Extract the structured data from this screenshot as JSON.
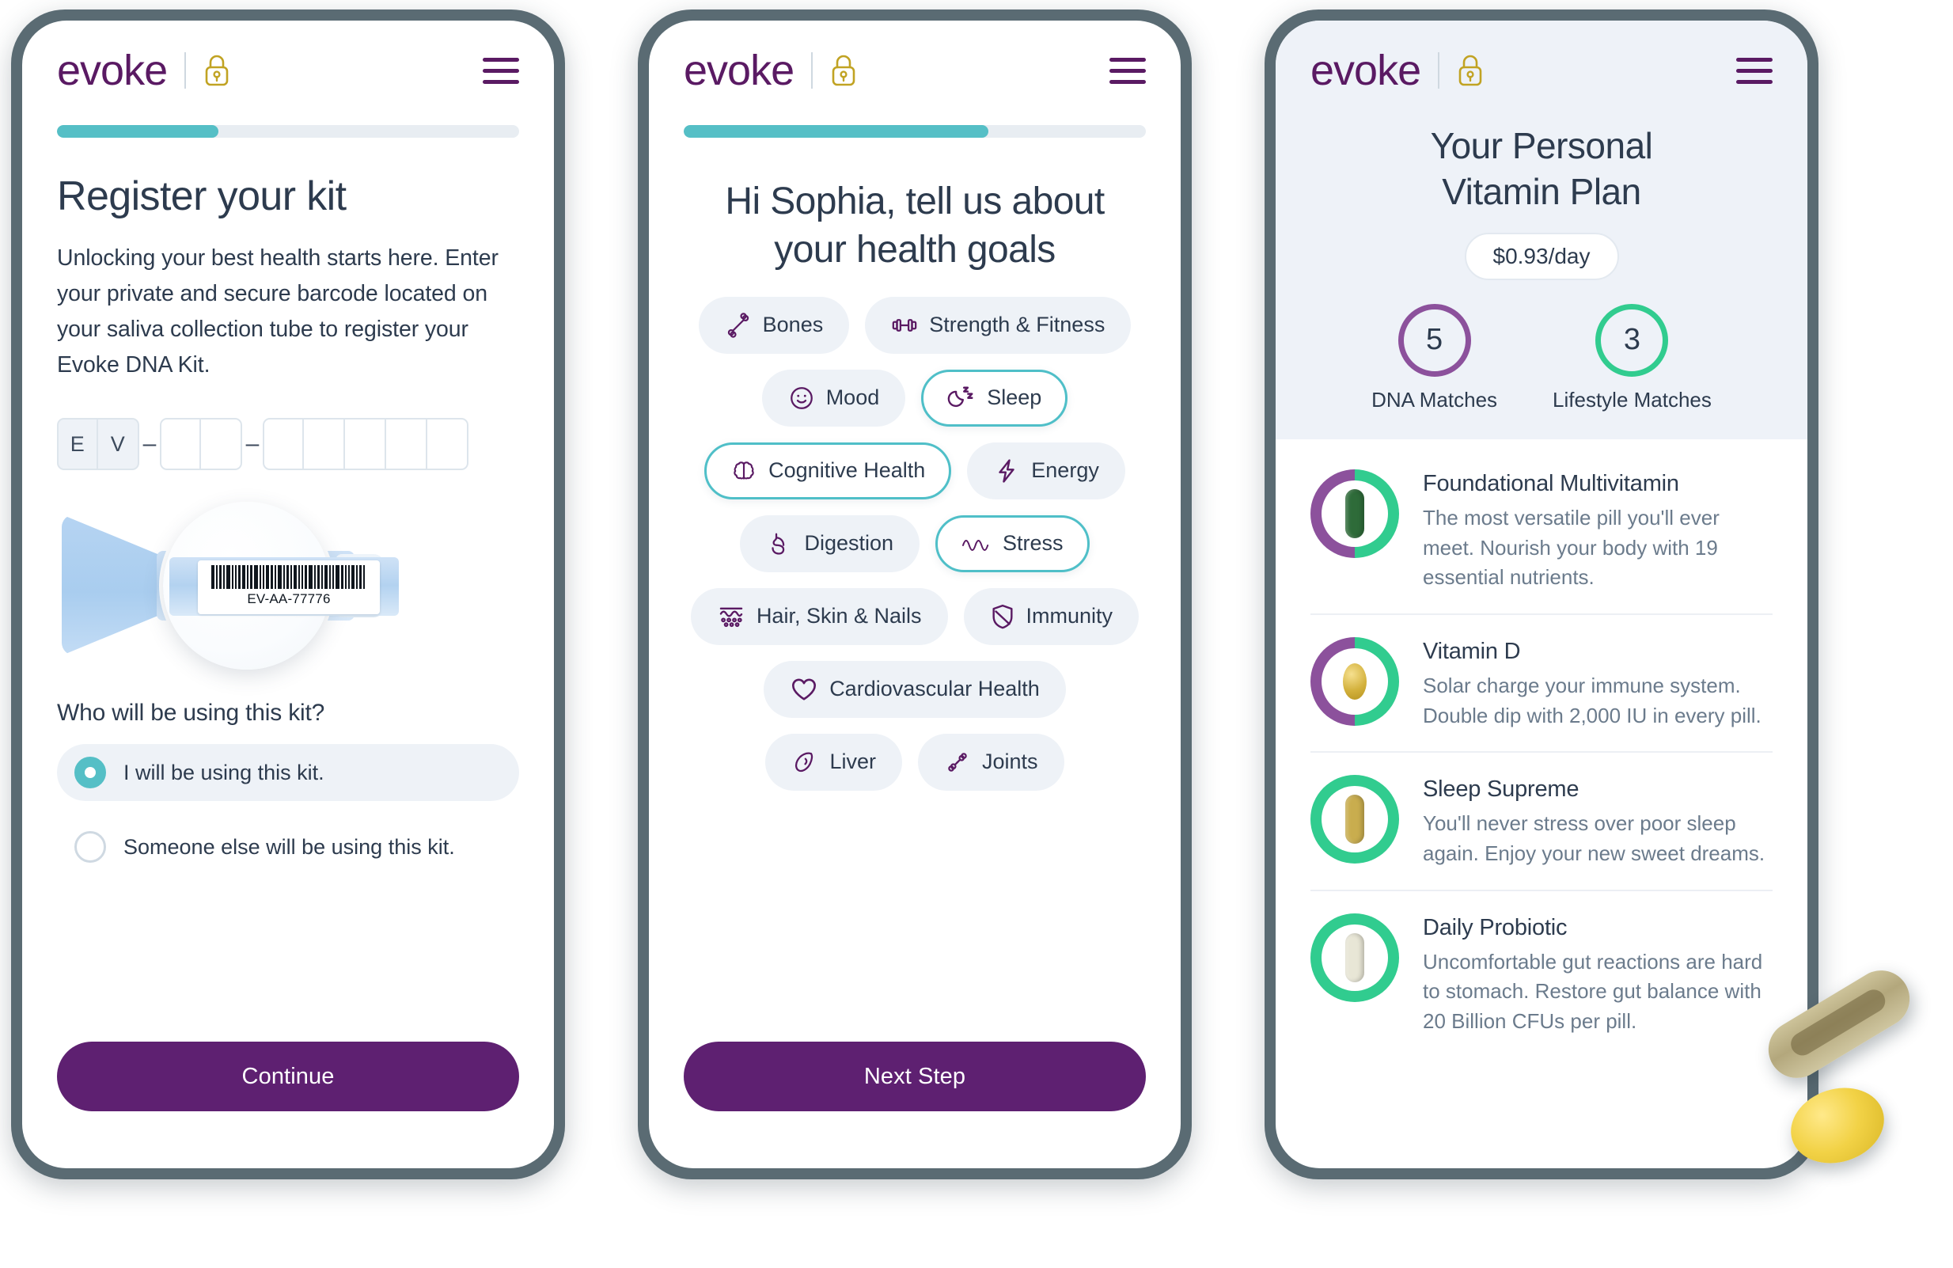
{
  "brand": {
    "wordmark": "evoke",
    "lock_icon": "lock-icon",
    "menu_icon": "hamburger-menu-icon"
  },
  "phone1": {
    "progress_percent": 35,
    "title": "Register your kit",
    "description": "Unlocking your best health starts here. Enter your private and secure barcode located on your saliva collection tube to register your Evoke DNA Kit.",
    "code_input": {
      "prefix": [
        "E",
        "V"
      ],
      "separator": "–",
      "group2": [
        "",
        ""
      ],
      "group3": [
        "",
        "",
        "",
        "",
        ""
      ]
    },
    "illustration": {
      "barcode_label": "EV-AA-77776"
    },
    "question": "Who will be using this kit?",
    "options": [
      {
        "label": "I will be using this kit.",
        "selected": true
      },
      {
        "label": "Someone else will be using this kit.",
        "selected": false
      }
    ],
    "cta_label": "Continue"
  },
  "phone2": {
    "progress_percent": 66,
    "title": "Hi Sophia, tell us about your health goals",
    "chip_rows": [
      [
        {
          "label": "Bones",
          "icon": "bone-icon",
          "selected": false
        },
        {
          "label": "Strength & Fitness",
          "icon": "dumbbell-icon",
          "selected": false
        }
      ],
      [
        {
          "label": "Mood",
          "icon": "smiley-face-icon",
          "selected": false
        },
        {
          "label": "Sleep",
          "icon": "moon-zzz-icon",
          "selected": true
        }
      ],
      [
        {
          "label": "Cognitive Health",
          "icon": "brain-icon",
          "selected": true
        },
        {
          "label": "Energy",
          "icon": "lightning-bolt-icon",
          "selected": false
        }
      ],
      [
        {
          "label": "Digestion",
          "icon": "stomach-icon",
          "selected": false
        },
        {
          "label": "Stress",
          "icon": "wave-icon",
          "selected": true
        }
      ],
      [
        {
          "label": "Hair, Skin & Nails",
          "icon": "hair-skin-nails-icon",
          "selected": false
        },
        {
          "label": "Immunity",
          "icon": "shield-icon",
          "selected": false
        }
      ],
      [
        {
          "label": "Cardiovascular Health",
          "icon": "heart-icon",
          "selected": false
        }
      ],
      [
        {
          "label": "Liver",
          "icon": "liver-icon",
          "selected": false
        },
        {
          "label": "Joints",
          "icon": "joints-icon",
          "selected": false
        }
      ]
    ],
    "cta_label": "Next Step"
  },
  "phone3": {
    "title_line1": "Your Personal",
    "title_line2": "Vitamin Plan",
    "price": "$0.93/day",
    "matches": [
      {
        "count": "5",
        "caption": "DNA Matches",
        "ring": "purple"
      },
      {
        "count": "3",
        "caption": "Lifestyle Matches",
        "ring": "green"
      }
    ],
    "supplements": [
      {
        "name": "Foundational Multivitamin",
        "description": "The most versatile pill you'll ever meet. Nourish your body with 19 essential nutrients.",
        "ring": "split",
        "pill_color": "#2e6b39",
        "pill_shape": "capsule-tall"
      },
      {
        "name": "Vitamin D",
        "description": "Solar charge your immune system. Double dip with 2,000 IU in every pill.",
        "ring": "split",
        "pill_color": "#d3b13c",
        "pill_shape": "softgel"
      },
      {
        "name": "Sleep Supreme",
        "description": "You'll never stress over poor sleep again. Enjoy your new sweet dreams.",
        "ring": "green",
        "pill_color": "#c9ad4e",
        "pill_shape": "capsule-tall"
      },
      {
        "name": "Daily Probiotic",
        "description": "Uncomfortable gut reactions are hard to stomach. Restore gut balance with 20 Billion CFUs per pill.",
        "ring": "green",
        "pill_color": "#e8e6d6",
        "pill_shape": "capsule-tall"
      }
    ]
  },
  "colors": {
    "brand_purple": "#5a1a63",
    "button_purple": "#5e2071",
    "teal": "#55bfc6",
    "green": "#31cc8f",
    "ring_purple": "#8c519c",
    "text_dark": "#2d3b4e",
    "text_muted": "#6b7b8c",
    "chip_bg": "#eef2f7",
    "phone_frame": "#5a6b73"
  }
}
